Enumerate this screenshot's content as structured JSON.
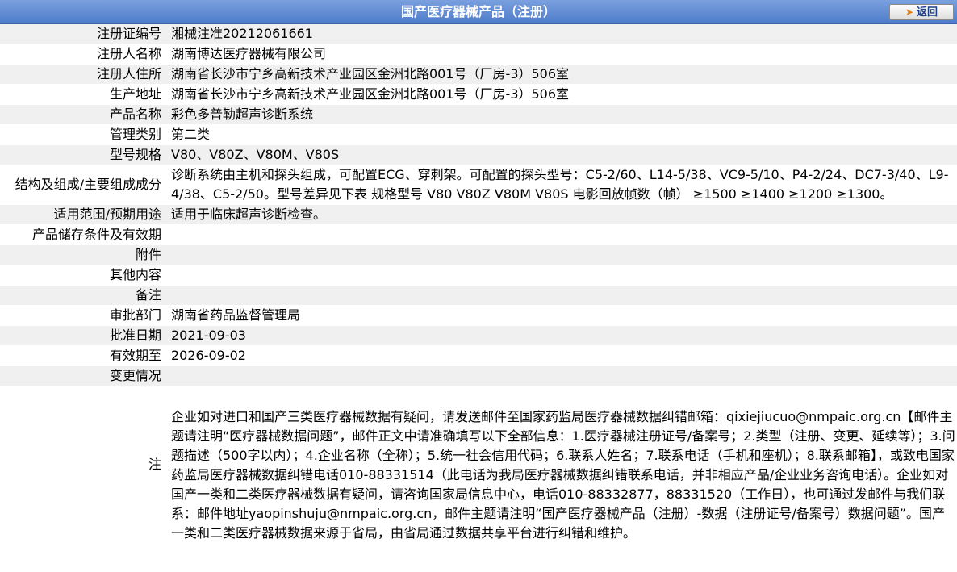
{
  "header": {
    "title": "国产医疗器械产品（注册）",
    "back_label": "返回"
  },
  "rows": [
    {
      "label": "注册证编号",
      "value": "湘械注准20212061661"
    },
    {
      "label": "注册人名称",
      "value": "湖南博达医疗器械有限公司"
    },
    {
      "label": "注册人住所",
      "value": "湖南省长沙市宁乡高新技术产业园区金洲北路001号（厂房-3）506室"
    },
    {
      "label": "生产地址",
      "value": "湖南省长沙市宁乡高新技术产业园区金洲北路001号（厂房-3）506室"
    },
    {
      "label": "产品名称",
      "value": "彩色多普勒超声诊断系统"
    },
    {
      "label": "管理类别",
      "value": "第二类"
    },
    {
      "label": "型号规格",
      "value": "V80、V80Z、V80M、V80S"
    },
    {
      "label": "结构及组成/主要组成成分",
      "value": "诊断系统由主机和探头组成，可配置ECG、穿刺架。可配置的探头型号：C5-2/60、L14-5/38、VC9-5/10、P4-2/24、DC7-3/40、L9-4/38、C5-2/50。型号差异见下表 规格型号 V80 V80Z V80M V80S 电影回放帧数（帧） ≥1500 ≥1400 ≥1200 ≥1300。"
    },
    {
      "label": "适用范围/预期用途",
      "value": "适用于临床超声诊断检查。"
    },
    {
      "label": "产品储存条件及有效期",
      "value": ""
    },
    {
      "label": "附件",
      "value": ""
    },
    {
      "label": "其他内容",
      "value": ""
    },
    {
      "label": "备注",
      "value": ""
    },
    {
      "label": "审批部门",
      "value": "湖南省药品监督管理局"
    },
    {
      "label": "批准日期",
      "value": "2021-09-03"
    },
    {
      "label": "有效期至",
      "value": "2026-09-02"
    },
    {
      "label": "变更情况",
      "value": ""
    }
  ],
  "note": {
    "label": "注",
    "text": "企业如对进口和国产三类医疗器械数据有疑问，请发送邮件至国家药监局医疗器械数据纠错邮箱：qixiejiucuo@nmpaic.org.cn【邮件主题请注明“医疗器械数据问题”，邮件正文中请准确填写以下全部信息：1.医疗器械注册证号/备案号；2.类型（注册、变更、延续等）；3.问题描述（500字以内）；4.企业名称（全称）；5.统一社会信用代码；6.联系人姓名；7.联系电话（手机和座机）；8.联系邮箱】，或致电国家药监局医疗器械数据纠错电话010-88331514（此电话为我局医疗器械数据纠错联系电话，并非相应产品/企业业务咨询电话）。企业如对国产一类和二类医疗器械数据有疑问，请咨询国家局信息中心，电话010-88332877，88331520（工作日），也可通过发邮件与我们联系：邮件地址yaopinshuju@nmpaic.org.cn，邮件主题请注明“国产医疗器械产品（注册）-数据（注册证号/备案号）数据问题”。国产一类和二类医疗器械数据来源于省局，由省局通过数据共享平台进行纠错和维护。"
  },
  "colors": {
    "header_bg": "#5b86d3",
    "row_alt_bg": "#f0f0f0",
    "back_text": "#1e3e8a",
    "back_arrow": "#e07a12"
  },
  "icons": {
    "back": "arrow-right-icon"
  }
}
